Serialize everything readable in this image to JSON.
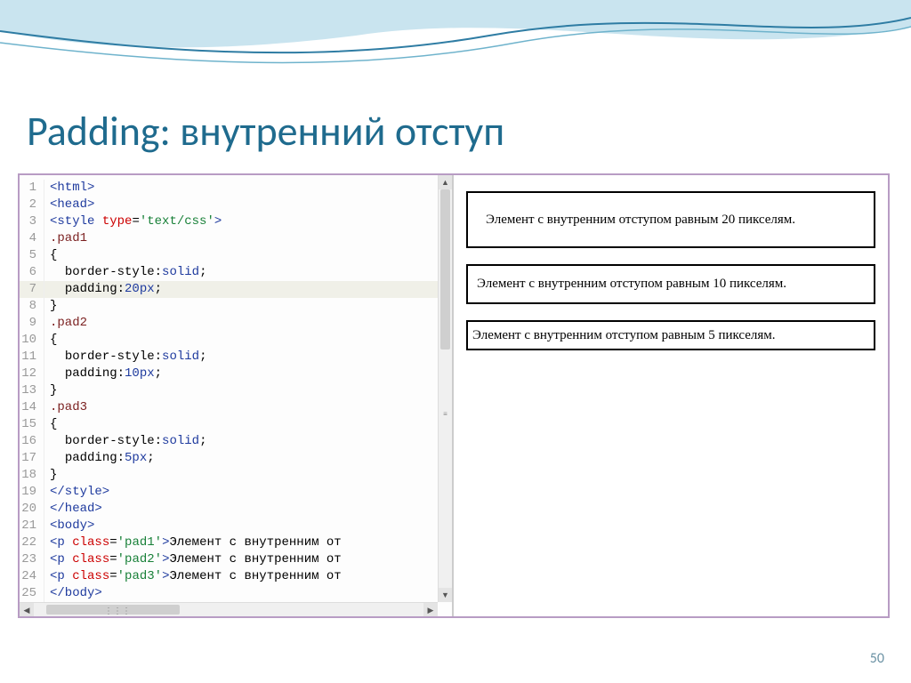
{
  "title": "Padding: внутренний отступ",
  "page_number": "50",
  "code": [
    {
      "n": "1",
      "html": "<span class='tag'>&lt;html&gt;</span>"
    },
    {
      "n": "2",
      "html": "<span class='tag'>&lt;head&gt;</span>"
    },
    {
      "n": "3",
      "html": "<span class='tag'>&lt;style</span> <span class='attr'>type</span>=<span class='str'>'text/css'</span><span class='tag'>&gt;</span>"
    },
    {
      "n": "4",
      "html": "<span class='sel'>.pad1</span>"
    },
    {
      "n": "5",
      "html": "{"
    },
    {
      "n": "6",
      "html": "  <span class='prop'>border-style</span>:<span class='val'>solid</span>;"
    },
    {
      "n": "7",
      "html": "  <span class='prop'>padding</span>:<span class='val'>20px</span>;"
    },
    {
      "n": "8",
      "html": "}"
    },
    {
      "n": "9",
      "html": "<span class='sel'>.pad2</span>"
    },
    {
      "n": "10",
      "html": "{"
    },
    {
      "n": "11",
      "html": "  <span class='prop'>border-style</span>:<span class='val'>solid</span>;"
    },
    {
      "n": "12",
      "html": "  <span class='prop'>padding</span>:<span class='val'>10px</span>;"
    },
    {
      "n": "13",
      "html": "}"
    },
    {
      "n": "14",
      "html": "<span class='sel'>.pad3</span>"
    },
    {
      "n": "15",
      "html": "{"
    },
    {
      "n": "16",
      "html": "  <span class='prop'>border-style</span>:<span class='val'>solid</span>;"
    },
    {
      "n": "17",
      "html": "  <span class='prop'>padding</span>:<span class='val'>5px</span>;"
    },
    {
      "n": "18",
      "html": "}"
    },
    {
      "n": "19",
      "html": "<span class='tag'>&lt;/style&gt;</span>"
    },
    {
      "n": "20",
      "html": "<span class='tag'>&lt;/head&gt;</span>"
    },
    {
      "n": "21",
      "html": "<span class='tag'>&lt;body&gt;</span>"
    },
    {
      "n": "22",
      "html": "<span class='tag'>&lt;p</span> <span class='attr'>class</span>=<span class='str'>'pad1'</span><span class='tag'>&gt;</span>Элемент с внутренним от"
    },
    {
      "n": "23",
      "html": "<span class='tag'>&lt;p</span> <span class='attr'>class</span>=<span class='str'>'pad2'</span><span class='tag'>&gt;</span>Элемент с внутренним от"
    },
    {
      "n": "24",
      "html": "<span class='tag'>&lt;p</span> <span class='attr'>class</span>=<span class='str'>'pad3'</span><span class='tag'>&gt;</span>Элемент с внутренним от"
    },
    {
      "n": "25",
      "html": "<span class='tag'>&lt;/body&gt;</span>"
    }
  ],
  "render": {
    "box1": "Элемент с внутренним отступом равным 20 пикселям.",
    "box2": "Элемент с внутренним отступом равным 10 пикселям.",
    "box3": "Элемент с внутренним отступом равным 5 пикселям."
  }
}
